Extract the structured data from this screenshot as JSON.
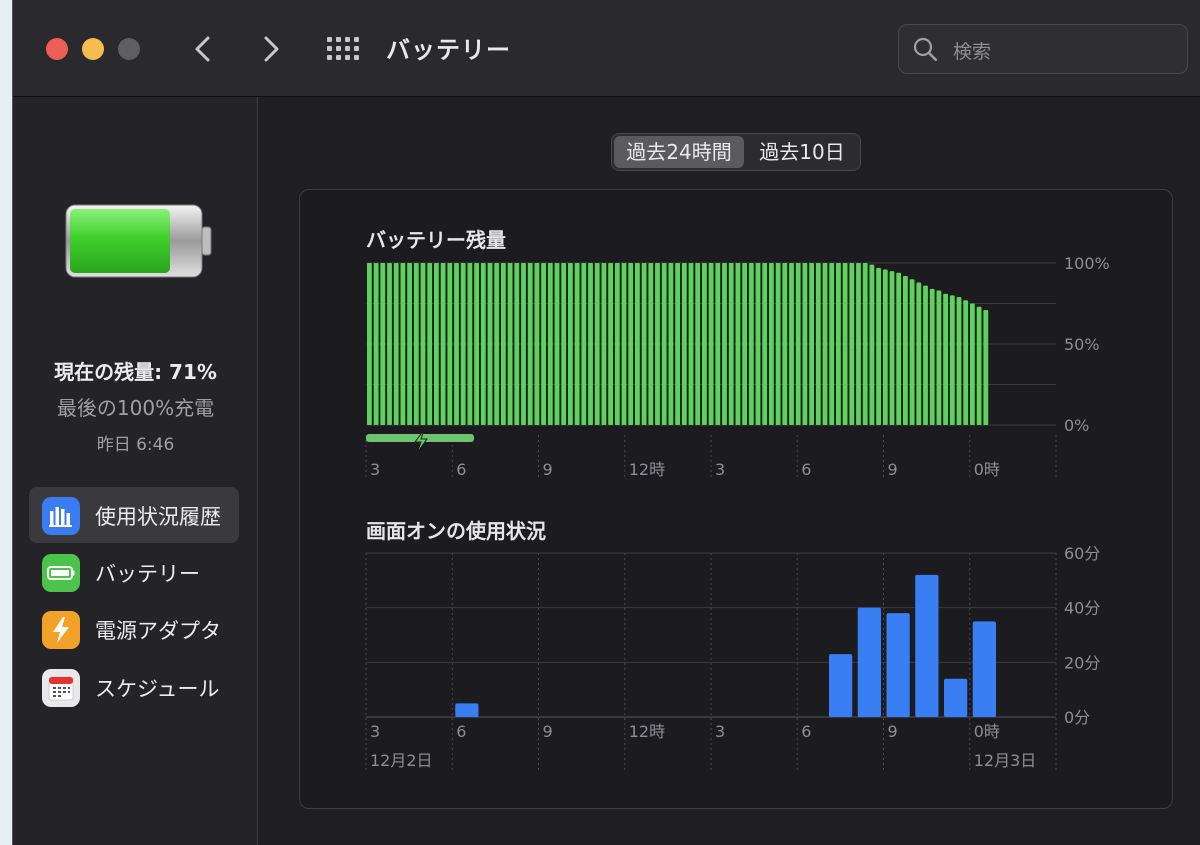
{
  "window": {
    "title": "バッテリー",
    "search_placeholder": "検索",
    "traffic_colors": [
      "#ed5f56",
      "#f5bd4f",
      "#5f5e63"
    ]
  },
  "sidebar": {
    "current_level": "現在の残量: 71%",
    "last_full_charge": "最後の100%充電",
    "last_full_charge_time": "昨日 6:46",
    "items": [
      {
        "label": "使用状況履歴",
        "icon": "bar-chart-icon",
        "color": "#3a7cf2",
        "selected": true
      },
      {
        "label": "バッテリー",
        "icon": "battery-icon",
        "color": "#4cc44c",
        "selected": false
      },
      {
        "label": "電源アダプタ",
        "icon": "lightning-icon",
        "color": "#f2a229",
        "selected": false
      },
      {
        "label": "スケジュール",
        "icon": "calendar-icon",
        "color": "#e9e9ec",
        "selected": false
      }
    ]
  },
  "segmented": {
    "options": [
      "過去24時間",
      "過去10日"
    ],
    "selected": 0
  },
  "chart_data": [
    {
      "type": "bar",
      "title": "バッテリー残量",
      "y_ticks": [
        "100%",
        "50%",
        "0%"
      ],
      "ylim": [
        0,
        100
      ],
      "x_tick_labels": [
        "3",
        "6",
        "9",
        "12時",
        "3",
        "6",
        "9",
        "0時"
      ],
      "charging_indicator": true,
      "color": "#5dd35d",
      "values": [
        100,
        100,
        100,
        100,
        100,
        100,
        100,
        100,
        100,
        100,
        100,
        100,
        100,
        100,
        100,
        100,
        100,
        100,
        100,
        100,
        100,
        100,
        100,
        100,
        100,
        100,
        100,
        100,
        100,
        100,
        100,
        100,
        100,
        100,
        100,
        100,
        100,
        100,
        100,
        100,
        100,
        100,
        100,
        100,
        100,
        100,
        100,
        100,
        100,
        100,
        100,
        100,
        100,
        100,
        100,
        100,
        100,
        100,
        100,
        100,
        100,
        100,
        100,
        100,
        100,
        100,
        100,
        100,
        100,
        100,
        100,
        100,
        100,
        100,
        100,
        99,
        97,
        96,
        95,
        94,
        92,
        90,
        88,
        86,
        84,
        83,
        81,
        80,
        79,
        77,
        75,
        73,
        71
      ]
    },
    {
      "type": "bar",
      "title": "画面オンの使用状況",
      "y_ticks": [
        "60分",
        "40分",
        "20分",
        "0分"
      ],
      "ylim": [
        0,
        60
      ],
      "x_tick_labels": [
        "3",
        "6",
        "9",
        "12時",
        "3",
        "6",
        "9",
        "0時"
      ],
      "date_labels": [
        "12月2日",
        "12月3日"
      ],
      "color": "#3a7ef3",
      "values": [
        0,
        0,
        0,
        5,
        0,
        0,
        0,
        0,
        0,
        0,
        0,
        0,
        0,
        0,
        0,
        0,
        23,
        40,
        38,
        52,
        14,
        35
      ]
    }
  ]
}
